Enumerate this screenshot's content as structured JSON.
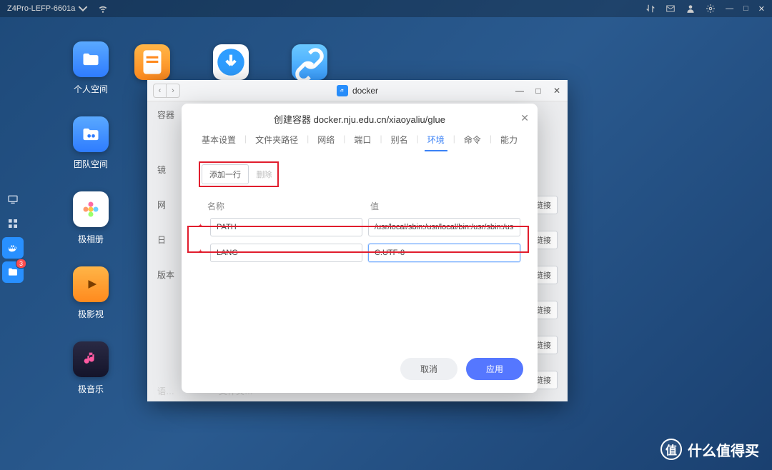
{
  "topbar": {
    "host": "Z4Pro-LEFP-6601a"
  },
  "desktop": {
    "icons": [
      {
        "label": "个人空间"
      },
      {
        "label": "团队空间"
      },
      {
        "label": "极相册"
      },
      {
        "label": "极影视"
      },
      {
        "label": "极音乐"
      }
    ]
  },
  "dock_badge": "3",
  "docker_window": {
    "title": "docker",
    "side_label": "容器",
    "side_char1": "镜",
    "side_char_net": "网",
    "side_char_day": "日",
    "side_char_ver": "版本",
    "side_btn": "链接",
    "footer1": "语…",
    "footer2": "文件夹…"
  },
  "modal": {
    "title": "创建容器 docker.nju.edu.cn/xiaoyaliu/glue",
    "tabs": [
      "基本设置",
      "文件夹路径",
      "网络",
      "端口",
      "别名",
      "环境",
      "命令",
      "能力"
    ],
    "active_tab": "环境",
    "add_row": "添加一行",
    "delete": "删除",
    "col_name": "名称",
    "col_value": "值",
    "rows": [
      {
        "name": "PATH",
        "value": "/usr/local/sbin:/usr/local/bin:/usr/sbin:/usr/b"
      },
      {
        "name": "LANG",
        "value": "C.UTF-8"
      }
    ],
    "cancel": "取消",
    "apply": "应用"
  },
  "watermark": {
    "symbol": "值",
    "text": "什么值得买"
  }
}
